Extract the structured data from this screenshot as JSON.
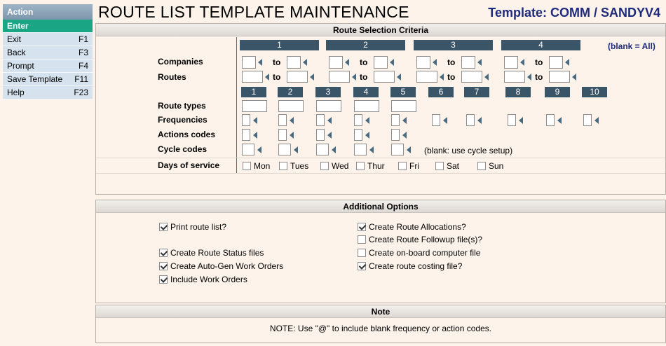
{
  "sidebar": {
    "header": "Action",
    "items": [
      {
        "label": "Enter",
        "key": ""
      },
      {
        "label": "Exit",
        "key": "F1"
      },
      {
        "label": "Back",
        "key": "F3"
      },
      {
        "label": "Prompt",
        "key": "F4"
      },
      {
        "label": "Save Template",
        "key": "F11"
      },
      {
        "label": "Help",
        "key": "F23"
      }
    ]
  },
  "header": {
    "title": "ROUTE LIST TEMPLATE MAINTENANCE",
    "template": "Template: COMM / SANDYV4"
  },
  "criteria": {
    "title": "Route Selection Criteria",
    "groups": [
      "1",
      "2",
      "3",
      "4"
    ],
    "blank_all": "(blank = All)",
    "companies_label": "Companies",
    "routes_label": "Routes",
    "to_label": "to",
    "type_columns": [
      "1",
      "2",
      "3",
      "4",
      "5",
      "6",
      "7",
      "8",
      "9",
      "10"
    ],
    "route_types_label": "Route types",
    "frequencies_label": "Frequencies",
    "actions_label": "Actions codes",
    "cycle_label": "Cycle codes",
    "cycle_note": "(blank: use cycle setup)",
    "days_label": "Days of service",
    "days": [
      {
        "label": "Mon",
        "checked": false
      },
      {
        "label": "Tues",
        "checked": false
      },
      {
        "label": "Wed",
        "checked": false
      },
      {
        "label": "Thur",
        "checked": false
      },
      {
        "label": "Fri",
        "checked": false
      },
      {
        "label": "Sat",
        "checked": false
      },
      {
        "label": "Sun",
        "checked": false
      }
    ]
  },
  "options": {
    "title": "Additional Options",
    "print_route_list": {
      "label": "Print route list?",
      "checked": true
    },
    "create_route_status": {
      "label": "Create Route Status files",
      "checked": true
    },
    "create_auto_gen": {
      "label": "Create Auto-Gen Work Orders",
      "checked": true
    },
    "include_work_orders": {
      "label": "Include Work Orders",
      "checked": true
    },
    "create_route_allocations": {
      "label": "Create Route Allocations?",
      "checked": true
    },
    "create_route_followup": {
      "label": "Create Route Followup file(s)?",
      "checked": false
    },
    "create_onboard": {
      "label": "Create on-board computer file",
      "checked": false
    },
    "create_costing": {
      "label": "Create route costing file?",
      "checked": true
    }
  },
  "note": {
    "title": "Note",
    "text": "NOTE: Use \"@\" to include blank frequency or action codes."
  }
}
